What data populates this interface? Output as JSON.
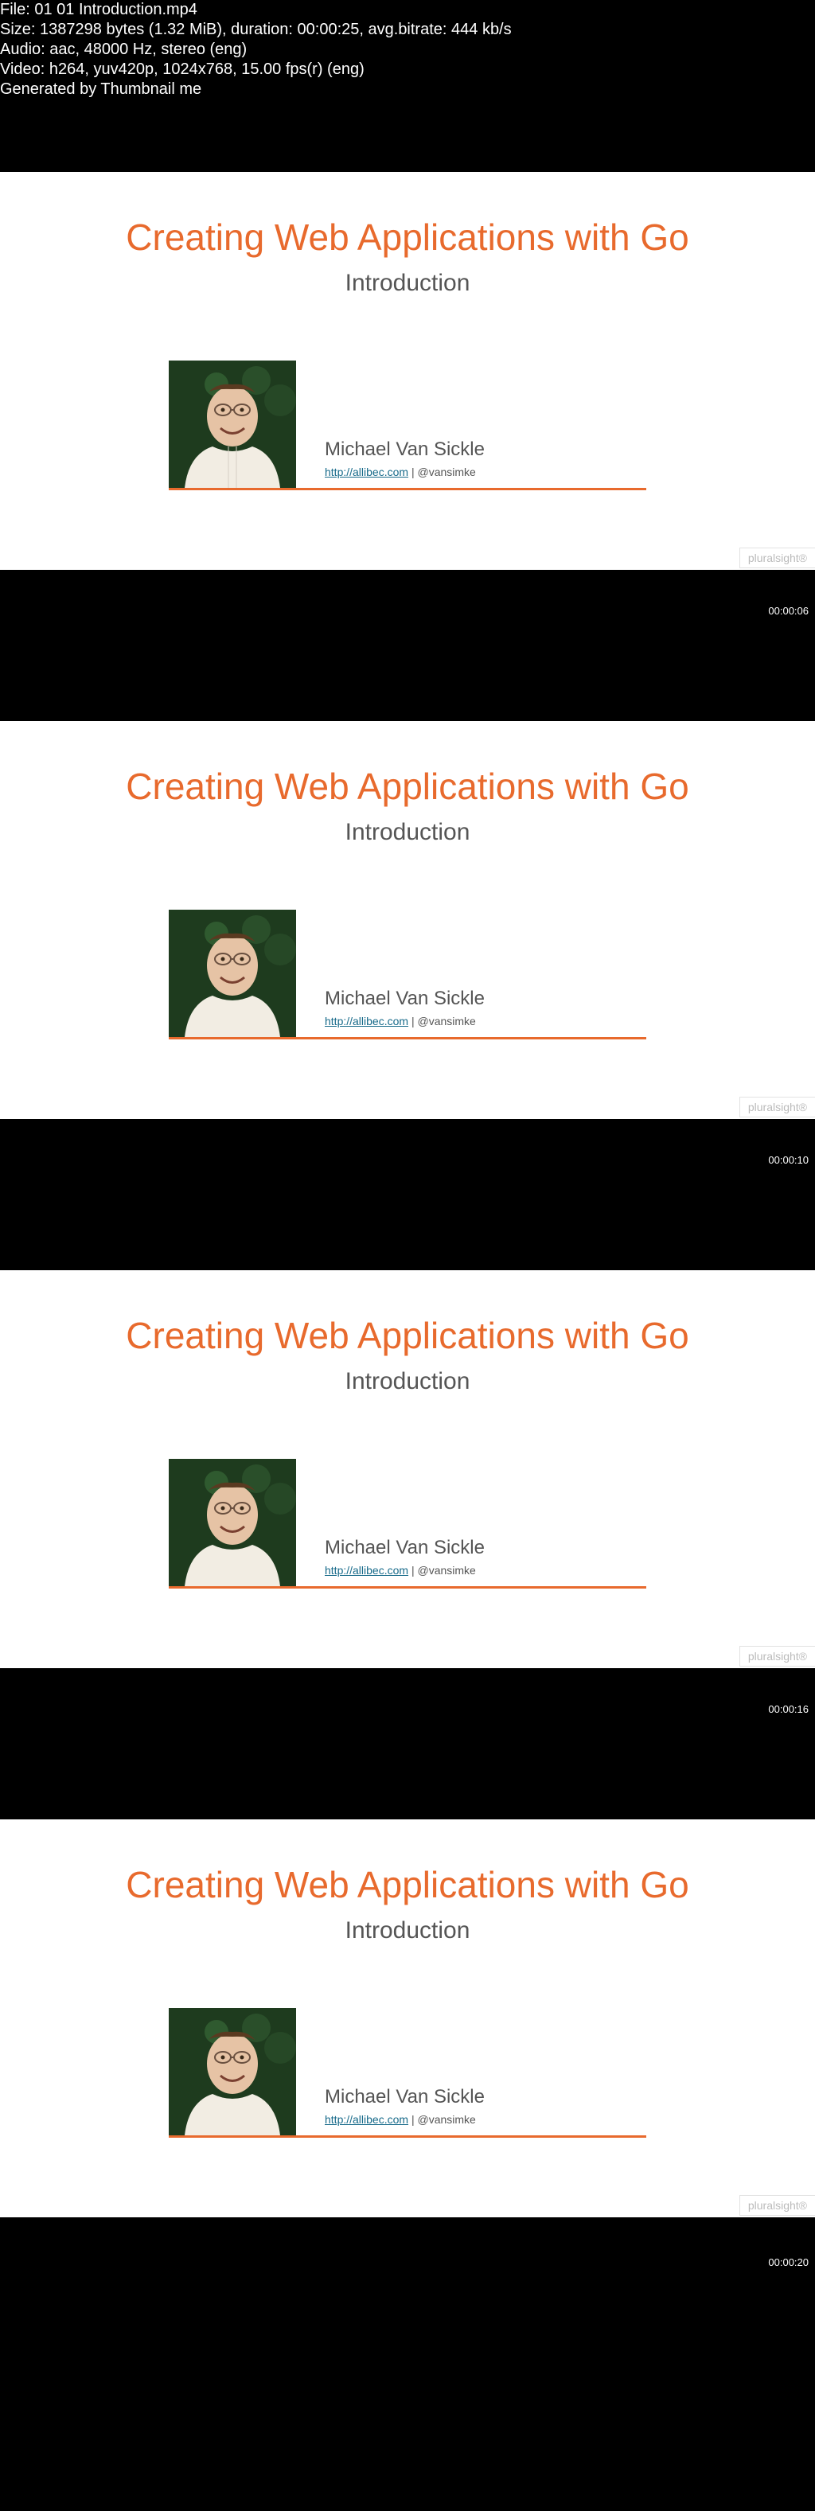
{
  "meta": {
    "file": "File: 01 01 Introduction.mp4",
    "size": "Size: 1387298 bytes (1.32 MiB), duration: 00:00:25, avg.bitrate: 444 kb/s",
    "audio": "Audio: aac, 48000 Hz, stereo (eng)",
    "video": "Video: h264, yuv420p, 1024x768, 15.00 fps(r) (eng)",
    "generated": "Generated by Thumbnail me"
  },
  "slide": {
    "title": "Creating Web Applications with Go",
    "subtitle": "Introduction",
    "author_name": "Michael Van Sickle",
    "author_url": "http://allibec.com",
    "author_handle": " | @vansimke"
  },
  "watermark": "pluralsight®",
  "timestamps": [
    "00:00:06",
    "00:00:10",
    "00:00:16",
    "00:00:20"
  ]
}
